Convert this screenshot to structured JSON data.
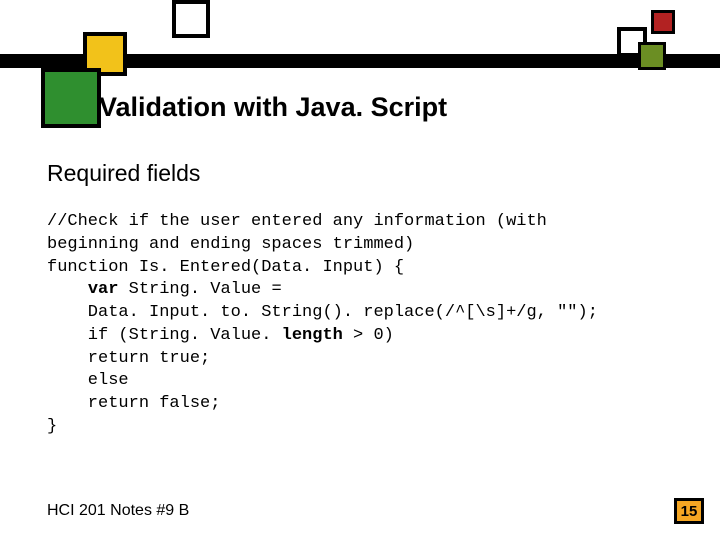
{
  "title": "Validation with Java. Script",
  "subtitle": "Required fields",
  "code": {
    "l1": "//Check if the user entered any information (with",
    "l2": "beginning and ending spaces trimmed)",
    "l3": "function Is. Entered(Data. Input) {",
    "l4a": "    ",
    "l4_kw": "var",
    "l4b": " String. Value =",
    "l5": "    Data. Input. to. String(). replace(/^[\\s]+/g, \"\");",
    "l6a": "    if (String. Value. ",
    "l6_kw": "length",
    "l6b": " > 0)",
    "l7": "    return true;",
    "l8": "    else",
    "l9": "    return false;",
    "l10": "}"
  },
  "footer": "HCI 201 Notes #9 B",
  "page": "15"
}
